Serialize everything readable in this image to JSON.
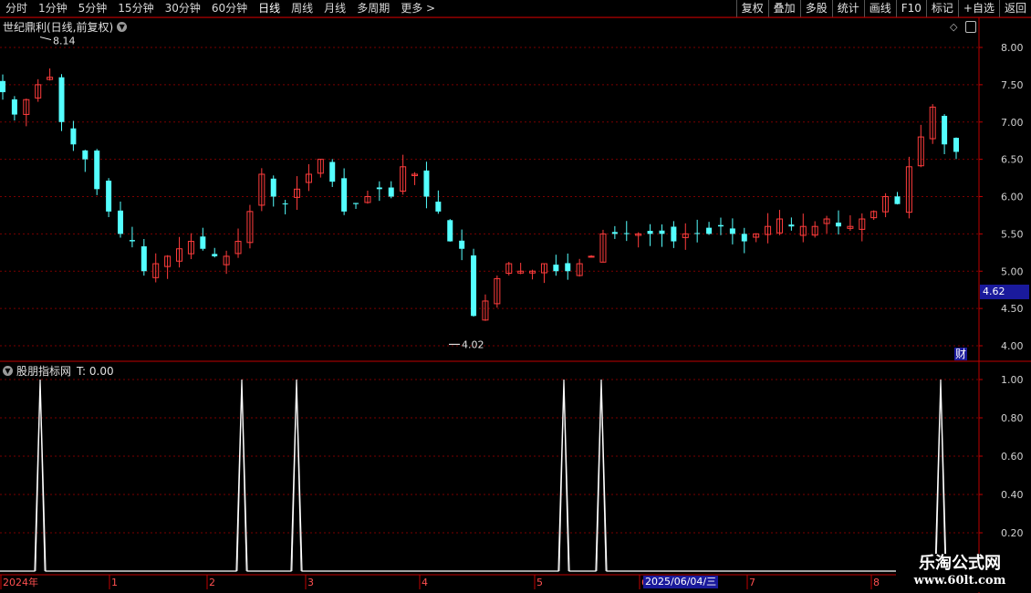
{
  "toolbar": {
    "periods": [
      "分时",
      "1分钟",
      "5分钟",
      "15分钟",
      "30分钟",
      "60分钟",
      "日线",
      "周线",
      "月线",
      "多周期",
      "更多 >"
    ],
    "active_period": "日线",
    "buttons": [
      "复权",
      "叠加",
      "多股",
      "统计",
      "画线",
      "F10",
      "标记",
      "+自选",
      "返回"
    ]
  },
  "main_chart": {
    "title": "世纪鼎利(日线,前复权)",
    "y_ticks": [
      "8.00",
      "7.50",
      "7.00",
      "6.50",
      "6.00",
      "5.50",
      "5.00",
      "4.50",
      "4.00"
    ],
    "high_label": "8.14",
    "low_label": "4.02",
    "current_price_tag": "4.62",
    "cai_badge": "财"
  },
  "indicator": {
    "title": "股朋指标网",
    "value_text": "T: 0.00",
    "y_ticks": [
      "1.00",
      "0.80",
      "0.60",
      "0.40",
      "0.20"
    ]
  },
  "x_axis": {
    "labels": [
      "2024年",
      "1",
      "2",
      "3",
      "4",
      "5",
      "6",
      "7",
      "8"
    ],
    "cursor_date": "2025/06/04/三"
  },
  "watermark": {
    "line1": "乐淘公式网",
    "line2": "www.60lt.com"
  },
  "colors": {
    "up": "#ff3c3c",
    "down": "#54ffff",
    "grid": "#7a0000",
    "axis": "#c00000"
  },
  "chart_data": {
    "type": "candlestick",
    "title": "世纪鼎利(日线,前复权)",
    "ylim": [
      3.85,
      8.3
    ],
    "x_labels": [
      "2024年",
      "1",
      "2",
      "3",
      "4",
      "5",
      "6",
      "7",
      "8"
    ],
    "annotations": {
      "high": 8.14,
      "low": 4.02,
      "last": 4.62
    },
    "closes_approx": [
      7.4,
      7.1,
      7.3,
      7.5,
      7.6,
      7.0,
      6.7,
      6.5,
      6.1,
      5.8,
      5.5,
      5.4,
      5.0,
      5.1,
      5.2,
      5.3,
      5.4,
      5.3,
      5.2,
      5.2,
      5.4,
      5.8,
      6.3,
      6.0,
      5.9,
      6.1,
      6.3,
      6.5,
      6.2,
      5.8,
      5.9,
      6.0,
      6.1,
      6.0,
      6.4,
      6.3,
      6.0,
      5.8,
      5.4,
      5.3,
      4.4,
      4.6,
      4.9,
      5.1,
      5.0,
      5.0,
      5.1,
      5.0,
      5.0,
      5.1,
      5.2,
      5.5,
      5.5,
      5.5,
      5.5,
      5.5,
      5.5,
      5.4,
      5.5,
      5.5,
      5.5,
      5.6,
      5.5,
      5.4,
      5.5,
      5.6,
      5.7,
      5.6,
      5.6,
      5.6,
      5.7,
      5.6,
      5.6,
      5.7,
      5.8,
      6.0,
      5.9,
      6.4,
      6.8,
      7.2,
      6.7,
      6.6
    ]
  },
  "indicator_chart_data": {
    "type": "line",
    "ylim": [
      0.0,
      1.05
    ],
    "spikes_value": 1.0,
    "baseline_value": 0.0
  }
}
